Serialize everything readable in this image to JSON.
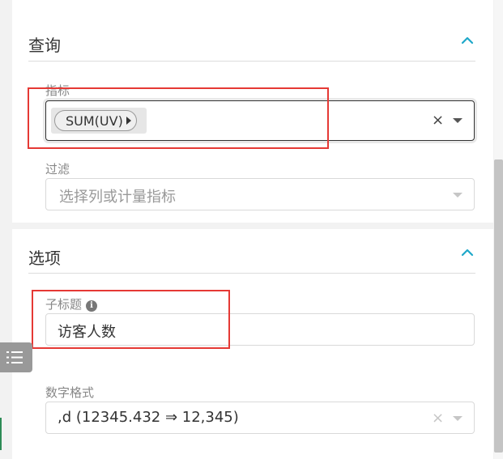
{
  "query_section": {
    "title": "查询",
    "metrics": {
      "label": "指标",
      "selected_tag": "SUM(UV)",
      "clear_symbol": "×"
    },
    "filter": {
      "label": "过滤",
      "placeholder": "选择列或计量指标"
    }
  },
  "options_section": {
    "title": "选项",
    "subtitle_field": {
      "label": "子标题",
      "info_symbol": "i",
      "value": "访客人数"
    },
    "number_format": {
      "label": "数字格式",
      "value": ",d (12345.432 ⇒ 12,345)",
      "clear_symbol": "×"
    }
  },
  "colors": {
    "accent": "#1fa8c9",
    "highlight": "#e53935"
  },
  "icons": {
    "collapse": "chevron-up-icon",
    "dropdown": "caret-down-icon",
    "side_toggle": "list-icon"
  }
}
